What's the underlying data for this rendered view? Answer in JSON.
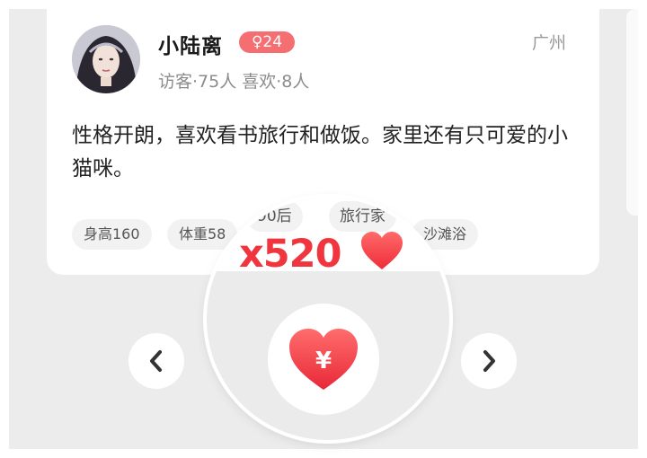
{
  "profile": {
    "name": "小陆离",
    "gender_age": "♀24",
    "city": "广州",
    "stats": "访客·75人 喜欢·8人",
    "bio": "性格开朗，喜欢看书旅行和做饭。家里还有只可爱的小猫咪。"
  },
  "tags": [
    "身高160",
    "体重58",
    "90后",
    "旅行家",
    "沙滩浴"
  ],
  "gift": {
    "count_label": "x520",
    "icon": "heart-icon",
    "button_icon": "heart-yuan-icon",
    "yuan_symbol": "¥"
  },
  "navigation": {
    "prev_icon": "chevron-left-icon",
    "next_icon": "chevron-right-icon"
  },
  "colors": {
    "accent": "#f0353e",
    "badge": "#f46e72",
    "background": "#ececec"
  }
}
